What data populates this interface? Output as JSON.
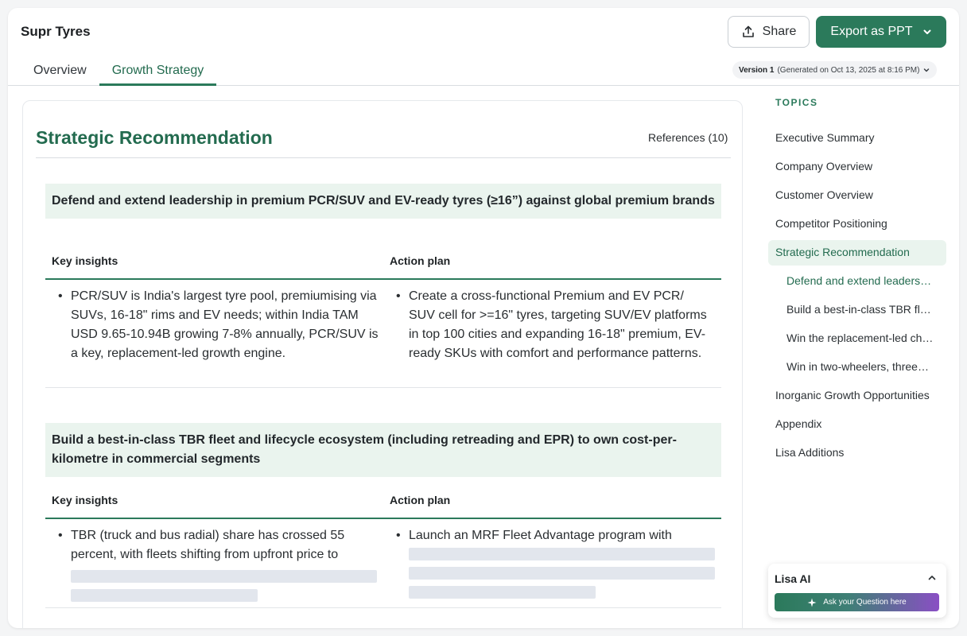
{
  "header": {
    "app_title": "Supr Tyres",
    "share_label": "Share",
    "export_label": "Export as PPT",
    "version_label": "Version 1",
    "version_detail": "(Generated on Oct 13, 2025 at 8:16 PM)"
  },
  "tabs": [
    {
      "label": "Overview"
    },
    {
      "label": "Growth Strategy"
    }
  ],
  "main": {
    "title": "Strategic Recommendation",
    "references": "References (10)",
    "col_insights": "Key insights",
    "col_action": "Action plan",
    "recommendations": [
      {
        "heading": "Defend and extend leadership in premium PCR/SUV and EV-ready tyres (≥16”) against global premium brands",
        "insight": "PCR/SUV is India's largest tyre pool, premiumising via SUVs, 16-18\" rims and EV needs; within India TAM USD 9.65-10.94B growing 7-8% annually, PCR/SUV is a key, replacement-led growth engine.",
        "action": "Create a cross-functional Premium and EV PCR/ SUV cell for >=16\" tyres, targeting SUV/EV platforms in top 100 cities and expanding 16-18\" premium, EV-ready SKUs with comfort and performance patterns."
      },
      {
        "heading": "Build a best-in-class TBR fleet and lifecycle ecosystem (including retreading and EPR) to own cost-per-kilometre in commercial segments",
        "insight": "TBR (truck and bus radial) share has crossed 55 percent, with fleets shifting from upfront price to",
        "action": "Launch an MRF Fleet Advantage program with"
      }
    ]
  },
  "sidebar": {
    "topics_label": "TOPICS",
    "items": [
      {
        "label": "Executive Summary"
      },
      {
        "label": "Company Overview"
      },
      {
        "label": "Customer Overview"
      },
      {
        "label": "Competitor Positioning"
      },
      {
        "label": "Strategic Recommendation"
      },
      {
        "label": "Defend and extend leaders…"
      },
      {
        "label": "Build a best-in-class TBR fl…"
      },
      {
        "label": "Win the replacement-led ch…"
      },
      {
        "label": "Win in two-wheelers, three…"
      },
      {
        "label": "Inorganic Growth Opportunities"
      },
      {
        "label": "Appendix"
      },
      {
        "label": "Lisa Additions"
      }
    ]
  },
  "lisa": {
    "title": "Lisa AI",
    "ask_label": "Ask your Question here"
  },
  "colors": {
    "accent": "#2b7a5b",
    "accent_light": "#eaf4ee",
    "ask_gradient_end": "#8a4fc4"
  },
  "icons": [
    "share-icon",
    "chevron-down-icon",
    "chevron-up-icon",
    "sparkle-icon"
  ]
}
